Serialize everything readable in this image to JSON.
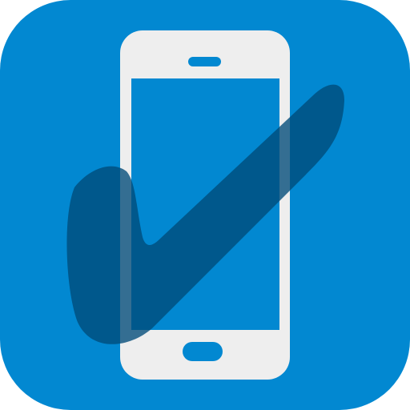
{
  "app_icon": {
    "symbol": "phone-with-checkmark-icon",
    "colors": {
      "background": "#0288d1",
      "phone_body": "#eeeeee",
      "phone_screen": "#0288d1",
      "checkmark": "#004a78"
    }
  }
}
